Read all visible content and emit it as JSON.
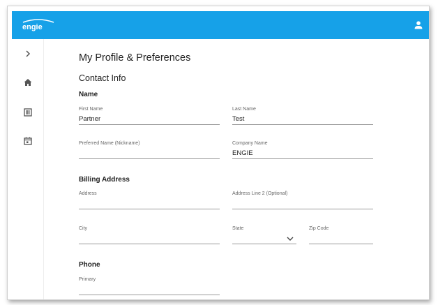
{
  "header": {
    "logo_text": "engie",
    "brand_color": "#16a1e8"
  },
  "sidebar": {
    "items": [
      {
        "icon": "chevron-right-icon"
      },
      {
        "icon": "home-icon"
      },
      {
        "icon": "document-list-icon"
      },
      {
        "icon": "calendar-icon"
      }
    ]
  },
  "page": {
    "title": "My Profile & Preferences",
    "section": "Contact Info"
  },
  "name_group": {
    "title": "Name",
    "first_name": {
      "label": "First Name",
      "value": "Partner"
    },
    "last_name": {
      "label": "Last Name",
      "value": "Test"
    },
    "preferred_name": {
      "label": "Preferred Name (Nickname)",
      "value": ""
    },
    "company_name": {
      "label": "Company Name",
      "value": "ENGIE"
    }
  },
  "billing_group": {
    "title": "Billing Address",
    "address": {
      "label": "Address",
      "value": ""
    },
    "address2": {
      "label": "Address Line 2 (Optional)",
      "value": ""
    },
    "city": {
      "label": "City",
      "value": ""
    },
    "state": {
      "label": "State",
      "value": ""
    },
    "zip": {
      "label": "Zip Code",
      "value": ""
    }
  },
  "phone_group": {
    "title": "Phone",
    "primary": {
      "label": "Primary",
      "value": ""
    }
  }
}
